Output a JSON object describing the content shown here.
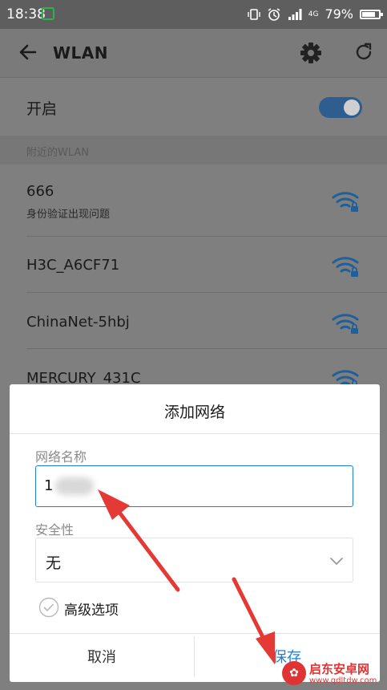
{
  "status_bar": {
    "time": "18:38",
    "network_label": "4G",
    "battery_text": "79%",
    "battery_level": 0.79,
    "icons": [
      "screenshot-icon",
      "vibrate-icon",
      "alarm-icon",
      "signal-icon",
      "dual-sim-4g-icon",
      "battery-icon"
    ]
  },
  "header": {
    "title": "WLAN",
    "icons": [
      "back-arrow-icon",
      "gear-icon",
      "refresh-icon"
    ]
  },
  "wlan_toggle": {
    "label": "开启",
    "enabled": true
  },
  "nearby_section": {
    "label": "附近的WLAN"
  },
  "networks": [
    {
      "ssid": "666",
      "status": "身份验证出现问题",
      "secured": true
    },
    {
      "ssid": "H3C_A6CF71",
      "status": "",
      "secured": true
    },
    {
      "ssid": "ChinaNet-5hbj",
      "status": "",
      "secured": true
    },
    {
      "ssid": "MERCURY_431C",
      "status": "",
      "secured": true
    }
  ],
  "dialog": {
    "title": "添加网络",
    "name_label": "网络名称",
    "name_value": "1",
    "security_label": "安全性",
    "security_value": "无",
    "advanced_label": "高级选项",
    "cancel_label": "取消",
    "save_label": "保存"
  },
  "colors": {
    "accent": "#1e7fd9",
    "wifi": "#1f5f9a",
    "annotation_arrow": "#e53935"
  },
  "watermark": {
    "name": "启东安卓网",
    "url": "www.qdltdw.com"
  }
}
